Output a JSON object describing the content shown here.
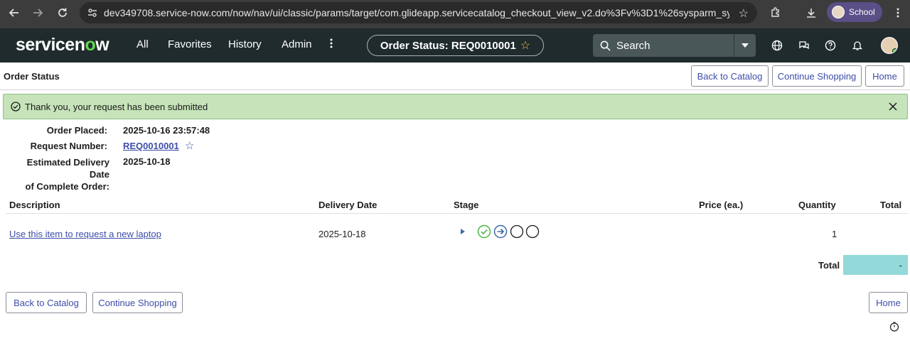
{
  "browser": {
    "url": "dev349708.service-now.com/now/nav/ui/classic/params/target/com.glideapp.servicecatalog_checkout_view_v2.do%3Fv%3D1%26sysparm_sys_id%3D...",
    "profile_label": "School"
  },
  "header": {
    "logo_prefix": "servicen",
    "logo_o": "o",
    "logo_suffix": "w",
    "nav": {
      "all": "All",
      "favorites": "Favorites",
      "history": "History",
      "admin": "Admin"
    },
    "status_pill": "Order Status: REQ0010001",
    "search_placeholder": "Search"
  },
  "page": {
    "title": "Order Status",
    "buttons": {
      "back_to_catalog": "Back to Catalog",
      "continue_shopping": "Continue Shopping",
      "home": "Home"
    },
    "alert": "Thank you, your request has been submitted",
    "info": {
      "order_placed_label": "Order Placed:",
      "order_placed_value": "2025-10-16 23:57:48",
      "request_number_label": "Request Number:",
      "request_number_value": "REQ0010001",
      "delivery_label_line1": "Estimated Delivery Date",
      "delivery_label_line2": "of Complete Order:",
      "delivery_value": "2025-10-18"
    },
    "table": {
      "headers": {
        "description": "Description",
        "delivery_date": "Delivery Date",
        "stage": "Stage",
        "price": "Price (ea.)",
        "quantity": "Quantity",
        "total": "Total"
      },
      "rows": [
        {
          "description": "Use this item to request a new laptop",
          "delivery_date": "2025-10-18",
          "price": "",
          "quantity": "1",
          "total": ""
        }
      ],
      "total_label": "Total",
      "total_value": "-"
    }
  },
  "colors": {
    "header_bg": "#1f2b2d",
    "logo_accent": "#62d84e",
    "link": "#3e4da9",
    "alert_bg": "#c6e3b9",
    "total_bg": "#94d9d9"
  }
}
